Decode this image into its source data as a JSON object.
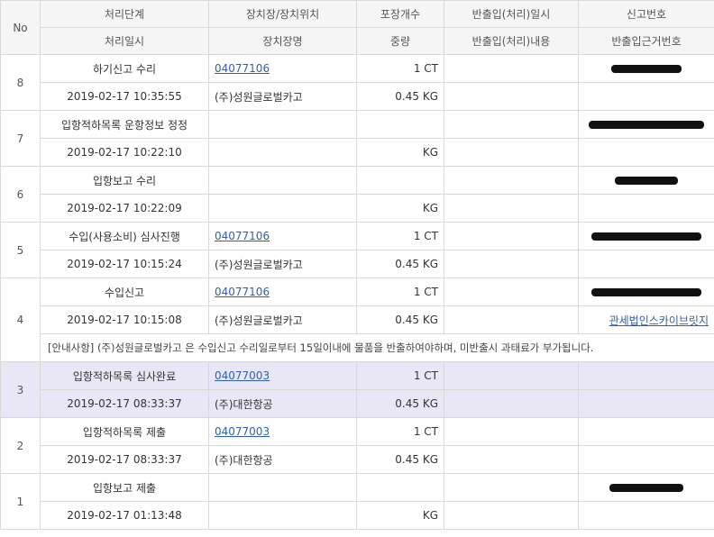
{
  "header": {
    "no": "No",
    "row1": [
      "처리단계",
      "장치장/장치위치",
      "포장개수",
      "반출입(처리)일시",
      "신고번호"
    ],
    "row2": [
      "처리일시",
      "장치장명",
      "중량",
      "반출입(처리)내용",
      "반출입근거번호"
    ]
  },
  "rows": [
    {
      "no": "8",
      "step": "하기신고 수리",
      "datetime": "2019-02-17 10:35:55",
      "location": "04077106",
      "location_name": "(주)성원글로벌카고",
      "count": "1 CT",
      "weight": "0.45 KG",
      "report_no": "redacted",
      "basis_no": ""
    },
    {
      "no": "7",
      "step": "입항적하목록 운항정보 정정",
      "datetime": "2019-02-17 10:22:10",
      "location": "",
      "location_name": "",
      "count": "",
      "weight": "KG",
      "report_no": "redacted",
      "basis_no": ""
    },
    {
      "no": "6",
      "step": "입항보고 수리",
      "datetime": "2019-02-17 10:22:09",
      "location": "",
      "location_name": "",
      "count": "",
      "weight": "KG",
      "report_no": "redacted",
      "basis_no": ""
    },
    {
      "no": "5",
      "step": "수입(사용소비) 심사진행",
      "datetime": "2019-02-17 10:15:24",
      "location": "04077106",
      "location_name": "(주)성원글로벌카고",
      "count": "1 CT",
      "weight": "0.45 KG",
      "report_no": "redacted",
      "basis_no": ""
    },
    {
      "no": "4",
      "step": "수입신고",
      "datetime": "2019-02-17 10:15:08",
      "location": "04077106",
      "location_name": "(주)성원글로벌카고",
      "count": "1 CT",
      "weight": "0.45 KG",
      "report_no": "redacted",
      "basis_no": "관세법인스카이브릿지",
      "notice": "[안내사항] (주)성원글로벌카고 은 수입신고 수리일로부터 15일이내에 물품을 반출하여야하며, 미반출시 과태료가 부가됩니다."
    },
    {
      "no": "3",
      "step": "입항적하목록 심사완료",
      "datetime": "2019-02-17 08:33:37",
      "location": "04077003",
      "location_name": "(주)대한항공",
      "count": "1 CT",
      "weight": "0.45 KG",
      "report_no": "",
      "basis_no": ""
    },
    {
      "no": "2",
      "step": "입항적하목록 제출",
      "datetime": "2019-02-17 08:33:37",
      "location": "04077003",
      "location_name": "(주)대한항공",
      "count": "1 CT",
      "weight": "0.45 KG",
      "report_no": "",
      "basis_no": ""
    },
    {
      "no": "1",
      "step": "입항보고 제출",
      "datetime": "2019-02-17 01:13:48",
      "location": "",
      "location_name": "",
      "count": "",
      "weight": "KG",
      "report_no": "redacted",
      "basis_no": ""
    }
  ],
  "colors": {
    "highlight_row": "#e9e6f5",
    "link": "#2f5fb3",
    "header_bg": "#f5f5f5"
  }
}
